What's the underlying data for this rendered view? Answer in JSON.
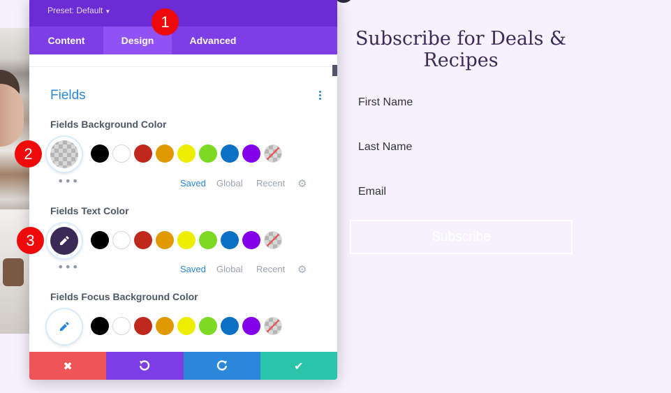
{
  "modal": {
    "preset": "Preset: Default",
    "tabs": [
      "Content",
      "Design",
      "Advanced"
    ],
    "active_tab": "Design",
    "section_title": "Fields",
    "fields": [
      {
        "label": "Fields Background Color",
        "current": "transparent",
        "has_palette_row": true
      },
      {
        "label": "Fields Text Color",
        "current": "#3b2a55",
        "has_palette_row": true
      },
      {
        "label": "Fields Focus Background Color",
        "current": "#ffffff",
        "has_palette_row": false
      }
    ],
    "swatches": [
      "#000000",
      "#ffffff",
      "#c0281d",
      "#e09900",
      "#eded00",
      "#7cda24",
      "#0c71c3",
      "#8300e9",
      "none"
    ],
    "palette_tabs": [
      "Saved",
      "Global",
      "Recent"
    ],
    "active_palette": "Saved",
    "footer_icons": [
      "close-icon",
      "undo-icon",
      "redo-icon",
      "check-icon"
    ]
  },
  "preview": {
    "title": "Subscribe for Deals & Recipes",
    "fields": [
      "First Name",
      "Last Name",
      "Email"
    ],
    "button": "Subscribe"
  },
  "markers": [
    "1",
    "2",
    "3"
  ],
  "colors": {
    "header": "#6b2bd5",
    "tabs": "#7e3ee6",
    "active_tab": "#9152f3",
    "accent_blue": "#2b87da",
    "cancel": "#ef5555",
    "save": "#29c4a9",
    "marker": "#ee0a0a"
  }
}
